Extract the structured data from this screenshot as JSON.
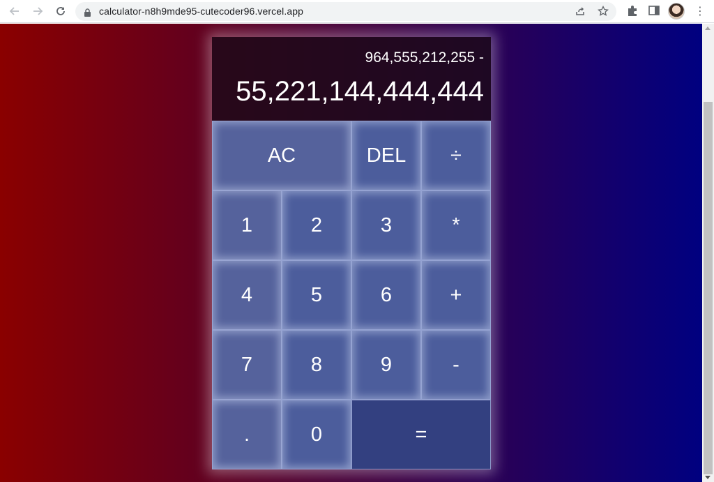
{
  "browser": {
    "url": "calculator-n8h9mde95-cutecoder96.vercel.app"
  },
  "calculator": {
    "previous_operand": "964,555,212,255 -",
    "current_operand": "55,221,144,444,444",
    "keys": {
      "ac": "AC",
      "del": "DEL",
      "divide": "÷",
      "one": "1",
      "two": "2",
      "three": "3",
      "multiply": "*",
      "four": "4",
      "five": "5",
      "six": "6",
      "plus": "+",
      "seven": "7",
      "eight": "8",
      "nine": "9",
      "minus": "-",
      "dot": ".",
      "zero": "0",
      "equals": "="
    }
  },
  "colors": {
    "gradient_left": "#8a0000",
    "gradient_right": "#000080",
    "key_bg": "#4c5d9c",
    "equals_bg": "#334080",
    "display_bg": "#1c0a18"
  }
}
